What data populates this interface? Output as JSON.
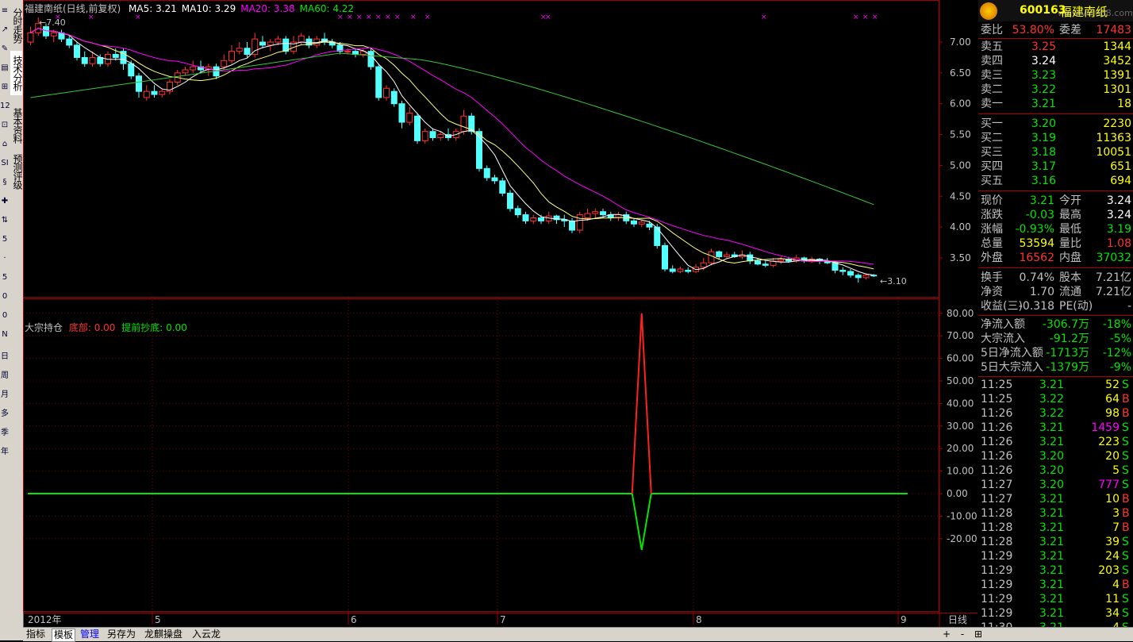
{
  "title": "福建南纸(日线,前复权)",
  "ma_labels": [
    {
      "text": "MA5: 3.21",
      "color": "#ffffff"
    },
    {
      "text": "MA10: 3.29",
      "color": "#ffffff"
    },
    {
      "text": "MA20: 3.38",
      "color": "#ff00ff"
    },
    {
      "text": "MA60: 4.22",
      "color": "#00e600"
    }
  ],
  "colors": {
    "up": "#ff3232",
    "down": "#54ffff",
    "ma5": "#ffffff",
    "ma10": "#ffff80",
    "ma20": "#ff00ff",
    "ma60": "#3ac43a",
    "grid": "#a00000"
  },
  "left_tabs": [
    "分时走势",
    "技术分析",
    "基本资料",
    "预测评级"
  ],
  "left_icons": [
    "≡",
    "↗",
    "✎",
    "▤",
    "⊞",
    "12",
    "⊡",
    "⌂",
    "SI",
    "§",
    "✚",
    "⇅",
    "5",
    "·",
    "5",
    "0",
    "0",
    "N",
    "日",
    "周",
    "月",
    "多",
    "季",
    "年"
  ],
  "price_axis": [
    "7.00",
    "6.50",
    "6.00",
    "5.50",
    "5.00",
    "4.50",
    "4.00",
    "3.50"
  ],
  "high_marker": "7.40",
  "low_marker": "3.10",
  "indicator": {
    "name": "大宗持仓",
    "line1": "底部: 0.00",
    "line2": "提前抄底: 0.00"
  },
  "indicator_axis": [
    "80.00",
    "70.00",
    "60.00",
    "50.00",
    "40.00",
    "30.00",
    "20.00",
    "10.00",
    "0.00",
    "-10.00",
    "-20.00"
  ],
  "date_axis": {
    "year": "2012年",
    "months": [
      "5",
      "6",
      "7",
      "8",
      "9"
    ],
    "period": "日线"
  },
  "bottom_tabs": [
    "指标",
    "模板",
    "管理",
    "另存为",
    "龙麒操盘",
    "入云龙"
  ],
  "bottom_right_buttons": [
    "+",
    "-",
    "⊞"
  ],
  "stock": {
    "code": "600163",
    "name": "福建南纸",
    "watermark": "www.vvt668.com"
  },
  "order_ratio": {
    "label1": "委比",
    "value1": "53.80%",
    "label2": "委差",
    "value2": "17483"
  },
  "asks": [
    {
      "label": "卖五",
      "price": "3.25",
      "vol": "1344",
      "color": "red"
    },
    {
      "label": "卖四",
      "price": "3.24",
      "vol": "3452",
      "color": "white"
    },
    {
      "label": "卖三",
      "price": "3.23",
      "vol": "1391",
      "color": "green"
    },
    {
      "label": "卖二",
      "price": "3.22",
      "vol": "1301",
      "color": "green"
    },
    {
      "label": "卖一",
      "price": "3.21",
      "vol": "18",
      "color": "green"
    }
  ],
  "bids": [
    {
      "label": "买一",
      "price": "3.20",
      "vol": "2230",
      "color": "green"
    },
    {
      "label": "买二",
      "price": "3.19",
      "vol": "11363",
      "color": "green"
    },
    {
      "label": "买三",
      "price": "3.18",
      "vol": "10051",
      "color": "green"
    },
    {
      "label": "买四",
      "price": "3.17",
      "vol": "651",
      "color": "green"
    },
    {
      "label": "买五",
      "price": "3.16",
      "vol": "694",
      "color": "green"
    }
  ],
  "quote": [
    {
      "l1": "现价",
      "v1": "3.21",
      "c1": "green",
      "l2": "今开",
      "v2": "3.24",
      "c2": "white"
    },
    {
      "l1": "涨跌",
      "v1": "-0.03",
      "c1": "green",
      "l2": "最高",
      "v2": "3.24",
      "c2": "white"
    },
    {
      "l1": "涨幅",
      "v1": "-0.93%",
      "c1": "green",
      "l2": "最低",
      "v2": "3.19",
      "c2": "green"
    },
    {
      "l1": "总量",
      "v1": "53594",
      "c1": "yellow",
      "l2": "量比",
      "v2": "1.08",
      "c2": "red"
    },
    {
      "l1": "外盘",
      "v1": "16562",
      "c1": "red",
      "l2": "内盘",
      "v2": "37032",
      "c2": "green"
    }
  ],
  "stats": [
    {
      "l1": "换手",
      "v1": "0.74%",
      "l2": "股本",
      "v2": "7.21亿"
    },
    {
      "l1": "净资",
      "v1": "1.70",
      "l2": "流通",
      "v2": "7.21亿"
    },
    {
      "l1": "收益(三)",
      "v1": "-0.318",
      "l2": "PE(动)",
      "v2": "-"
    }
  ],
  "flows": [
    {
      "label": "净流入额",
      "value": "-306.7万",
      "pct": "-18%"
    },
    {
      "label": "大宗流入",
      "value": "-91.2万",
      "pct": "-5%"
    },
    {
      "label": "5日净流入额",
      "value": "-1713万",
      "pct": "-12%"
    },
    {
      "label": "5日大宗流入",
      "value": "-1379万",
      "pct": "-9%"
    }
  ],
  "ticks": [
    {
      "time": "11:25",
      "price": "3.21",
      "vol": "52",
      "side": "S",
      "vc": "yellow"
    },
    {
      "time": "11:25",
      "price": "3.22",
      "vol": "64",
      "side": "B",
      "vc": "yellow"
    },
    {
      "time": "11:26",
      "price": "3.22",
      "vol": "98",
      "side": "B",
      "vc": "yellow"
    },
    {
      "time": "11:26",
      "price": "3.21",
      "vol": "1459",
      "side": "S",
      "vc": "magenta"
    },
    {
      "time": "11:26",
      "price": "3.21",
      "vol": "223",
      "side": "S",
      "vc": "yellow"
    },
    {
      "time": "11:26",
      "price": "3.20",
      "vol": "20",
      "side": "S",
      "vc": "yellow"
    },
    {
      "time": "11:26",
      "price": "3.20",
      "vol": "5",
      "side": "S",
      "vc": "yellow"
    },
    {
      "time": "11:27",
      "price": "3.20",
      "vol": "777",
      "side": "S",
      "vc": "magenta"
    },
    {
      "time": "11:27",
      "price": "3.21",
      "vol": "10",
      "side": "B",
      "vc": "yellow"
    },
    {
      "time": "11:28",
      "price": "3.21",
      "vol": "3",
      "side": "B",
      "vc": "yellow"
    },
    {
      "time": "11:28",
      "price": "3.21",
      "vol": "7",
      "side": "B",
      "vc": "yellow"
    },
    {
      "time": "11:28",
      "price": "3.21",
      "vol": "39",
      "side": "S",
      "vc": "yellow"
    },
    {
      "time": "11:29",
      "price": "3.21",
      "vol": "24",
      "side": "S",
      "vc": "yellow"
    },
    {
      "time": "11:29",
      "price": "3.21",
      "vol": "203",
      "side": "S",
      "vc": "yellow"
    },
    {
      "time": "11:29",
      "price": "3.21",
      "vol": "4",
      "side": "B",
      "vc": "yellow"
    },
    {
      "time": "11:29",
      "price": "3.21",
      "vol": "11",
      "side": "S",
      "vc": "yellow"
    },
    {
      "time": "11:29",
      "price": "3.21",
      "vol": "34",
      "side": "S",
      "vc": "yellow"
    },
    {
      "time": "11:30",
      "price": "3.21",
      "vol": "4",
      "side": "S",
      "vc": "yellow"
    }
  ],
  "chart_data": [
    {
      "type": "candlestick",
      "title": "福建南纸(日线,前复权)",
      "y_range": [
        3.1,
        7.4
      ],
      "candles": [
        [
          7.0,
          7.15,
          6.95,
          7.25
        ],
        [
          7.15,
          7.3,
          7.1,
          7.4
        ],
        [
          7.25,
          7.1,
          7.05,
          7.3
        ],
        [
          7.1,
          7.15,
          7.0,
          7.2
        ],
        [
          7.15,
          7.05,
          7.0,
          7.2
        ],
        [
          7.05,
          6.95,
          6.9,
          7.1
        ],
        [
          6.95,
          6.75,
          6.7,
          7.0
        ],
        [
          6.75,
          6.65,
          6.6,
          6.85
        ],
        [
          6.65,
          6.75,
          6.6,
          6.85
        ],
        [
          6.75,
          6.65,
          6.6,
          6.8
        ],
        [
          6.65,
          6.8,
          6.6,
          6.85
        ],
        [
          6.8,
          6.75,
          6.7,
          6.9
        ],
        [
          6.85,
          6.65,
          6.55,
          6.9
        ],
        [
          6.65,
          6.45,
          6.4,
          6.7
        ],
        [
          6.45,
          6.2,
          6.1,
          6.5
        ],
        [
          6.1,
          6.2,
          6.05,
          6.3
        ],
        [
          6.2,
          6.15,
          6.1,
          6.3
        ],
        [
          6.15,
          6.2,
          6.1,
          6.25
        ],
        [
          6.2,
          6.35,
          6.15,
          6.4
        ],
        [
          6.35,
          6.5,
          6.3,
          6.55
        ],
        [
          6.5,
          6.55,
          6.45,
          6.6
        ],
        [
          6.55,
          6.6,
          6.5,
          6.7
        ],
        [
          6.6,
          6.55,
          6.5,
          6.7
        ],
        [
          6.55,
          6.6,
          6.45,
          6.65
        ],
        [
          6.6,
          6.45,
          6.4,
          6.65
        ],
        [
          6.6,
          6.7,
          6.55,
          6.8
        ],
        [
          6.7,
          6.85,
          6.65,
          6.95
        ],
        [
          6.85,
          6.9,
          6.8,
          7.0
        ],
        [
          6.9,
          6.8,
          6.75,
          7.0
        ],
        [
          6.8,
          7.05,
          6.75,
          7.15
        ],
        [
          7.0,
          6.95,
          6.9,
          7.1
        ],
        [
          6.95,
          7.0,
          6.85,
          7.05
        ],
        [
          7.0,
          7.05,
          6.95,
          7.1
        ],
        [
          7.05,
          6.85,
          6.8,
          7.1
        ],
        [
          6.85,
          7.0,
          6.8,
          7.1
        ],
        [
          7.0,
          7.1,
          6.95,
          7.15
        ],
        [
          7.05,
          6.95,
          6.9,
          7.1
        ],
        [
          6.95,
          7.05,
          6.9,
          7.1
        ],
        [
          7.05,
          7.0,
          6.95,
          7.15
        ],
        [
          7.0,
          6.95,
          6.9,
          7.05
        ],
        [
          6.95,
          6.85,
          6.8,
          7.0
        ],
        [
          6.85,
          6.85,
          6.8,
          6.9
        ],
        [
          6.85,
          6.8,
          6.75,
          6.9
        ],
        [
          6.8,
          6.85,
          6.75,
          6.9
        ],
        [
          6.85,
          6.6,
          6.55,
          6.9
        ],
        [
          6.6,
          6.1,
          6.05,
          6.65
        ],
        [
          6.1,
          6.25,
          6.05,
          6.3
        ],
        [
          6.2,
          6.0,
          5.95,
          6.25
        ],
        [
          6.0,
          5.7,
          5.6,
          6.05
        ],
        [
          5.7,
          5.85,
          5.65,
          5.95
        ],
        [
          5.8,
          5.4,
          5.35,
          5.85
        ],
        [
          5.4,
          5.55,
          5.35,
          5.6
        ],
        [
          5.55,
          5.45,
          5.4,
          5.6
        ],
        [
          5.45,
          5.5,
          5.4,
          5.55
        ],
        [
          5.5,
          5.45,
          5.4,
          5.6
        ],
        [
          5.45,
          5.55,
          5.4,
          5.6
        ],
        [
          5.55,
          5.8,
          5.5,
          5.9
        ],
        [
          5.8,
          5.55,
          5.5,
          5.85
        ],
        [
          5.55,
          4.95,
          4.9,
          5.6
        ],
        [
          4.95,
          4.8,
          4.75,
          5.0
        ],
        [
          4.8,
          4.75,
          4.7,
          4.85
        ],
        [
          4.75,
          4.55,
          4.5,
          4.8
        ],
        [
          4.55,
          4.3,
          4.25,
          4.6
        ],
        [
          4.3,
          4.2,
          4.15,
          4.35
        ],
        [
          4.2,
          4.1,
          4.05,
          4.25
        ],
        [
          4.1,
          4.15,
          4.05,
          4.2
        ],
        [
          4.15,
          4.1,
          4.05,
          4.2
        ],
        [
          4.1,
          4.18,
          4.05,
          4.25
        ],
        [
          4.18,
          4.12,
          4.05,
          4.2
        ],
        [
          4.12,
          4.1,
          4.0,
          4.2
        ],
        [
          4.1,
          3.95,
          3.9,
          4.15
        ],
        [
          3.95,
          4.2,
          3.9,
          4.25
        ],
        [
          4.15,
          4.22,
          4.1,
          4.3
        ],
        [
          4.22,
          4.25,
          4.15,
          4.3
        ],
        [
          4.25,
          4.2,
          4.15,
          4.3
        ],
        [
          4.2,
          4.15,
          4.1,
          4.25
        ],
        [
          4.15,
          4.2,
          4.1,
          4.25
        ],
        [
          4.2,
          4.1,
          4.05,
          4.25
        ],
        [
          4.1,
          4.05,
          4.0,
          4.15
        ],
        [
          4.05,
          4.08,
          4.0,
          4.12
        ],
        [
          4.05,
          4.0,
          3.95,
          4.1
        ],
        [
          4.0,
          3.7,
          3.65,
          4.05
        ],
        [
          3.7,
          3.32,
          3.28,
          3.75
        ],
        [
          3.32,
          3.28,
          3.25,
          3.38
        ],
        [
          3.28,
          3.32,
          3.25,
          3.36
        ],
        [
          3.3,
          3.28,
          3.25,
          3.35
        ],
        [
          3.28,
          3.35,
          3.25,
          3.4
        ],
        [
          3.35,
          3.42,
          3.3,
          3.5
        ],
        [
          3.42,
          3.6,
          3.38,
          3.65
        ],
        [
          3.6,
          3.52,
          3.48,
          3.62
        ],
        [
          3.52,
          3.55,
          3.48,
          3.6
        ],
        [
          3.55,
          3.52,
          3.5,
          3.6
        ],
        [
          3.52,
          3.55,
          3.48,
          3.62
        ],
        [
          3.55,
          3.45,
          3.4,
          3.6
        ],
        [
          3.45,
          3.4,
          3.38,
          3.5
        ],
        [
          3.4,
          3.38,
          3.35,
          3.45
        ],
        [
          3.38,
          3.45,
          3.35,
          3.5
        ],
        [
          3.45,
          3.48,
          3.4,
          3.52
        ],
        [
          3.48,
          3.45,
          3.42,
          3.52
        ],
        [
          3.45,
          3.5,
          3.42,
          3.55
        ],
        [
          3.5,
          3.45,
          3.42,
          3.52
        ],
        [
          3.45,
          3.48,
          3.42,
          3.52
        ],
        [
          3.48,
          3.45,
          3.4,
          3.5
        ],
        [
          3.45,
          3.42,
          3.4,
          3.5
        ],
        [
          3.42,
          3.3,
          3.25,
          3.45
        ],
        [
          3.3,
          3.28,
          3.22,
          3.35
        ],
        [
          3.28,
          3.22,
          3.18,
          3.32
        ],
        [
          3.22,
          3.18,
          3.1,
          3.25
        ],
        [
          3.18,
          3.22,
          3.15,
          3.25
        ],
        [
          3.22,
          3.21,
          3.19,
          3.24
        ]
      ]
    },
    {
      "type": "line",
      "title": "大宗持仓",
      "y_range": [
        -25,
        85
      ],
      "series": [
        {
          "name": "底部",
          "values_note": "flat 0 except spike at index 79",
          "spike_index": 79,
          "spike_value": 80
        },
        {
          "name": "提前抄底",
          "spike_index": 79,
          "spike_value": -25
        }
      ]
    }
  ]
}
